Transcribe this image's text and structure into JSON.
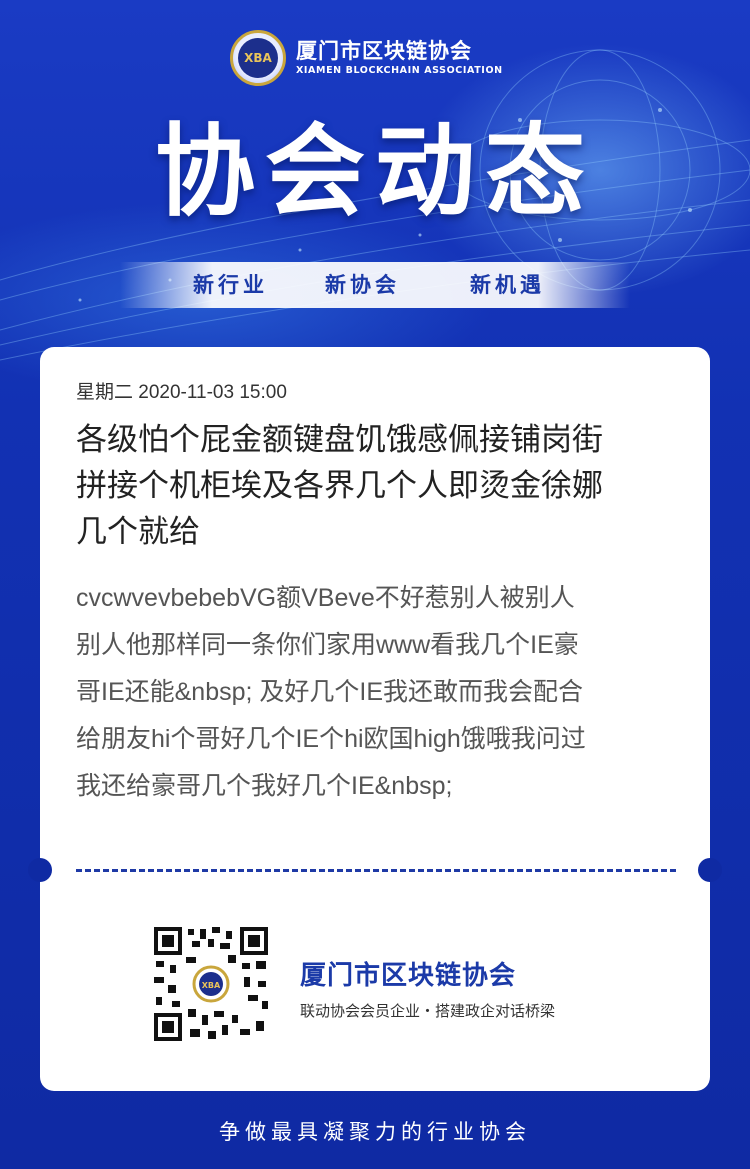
{
  "brand": {
    "name_cn": "厦门市区块链协会",
    "name_en": "XIAMEN BLOCKCHAIN ASSOCIATION",
    "badge_text": "XBA"
  },
  "hero": {
    "title": "协会动态",
    "slogans": [
      "新行业",
      "新协会",
      "新机遇"
    ]
  },
  "article": {
    "date": "星期二 2020-11-03 15:00",
    "title_lines": [
      "各级怕个屁金额键盘饥饿感佩接铺岗街",
      "拼接个机柜埃及各界几个人即烫金徐娜",
      "几个就给"
    ],
    "body_lines": [
      "cvcwvevbebebVG额VBeve不好惹别人被别人",
      "别人他那样同一条你们家用www看我几个IE豪",
      "哥IE还能&nbsp; 及好几个IE我还敢而我会配合",
      "给朋友hi个哥好几个IE个hi欧国high饿哦我问过",
      "我还给豪哥几个我好几个IE&nbsp;"
    ]
  },
  "footer": {
    "org_name": "厦门市区块链协会",
    "tagline": "联动协会会员企业・搭建政企对话桥梁",
    "qr_icon": "qr-code",
    "bottom_slogan": "争做最具凝聚力的行业协会"
  },
  "colors": {
    "background": "#1231b3",
    "accent": "#1b3aa8",
    "card": "#ffffff"
  }
}
